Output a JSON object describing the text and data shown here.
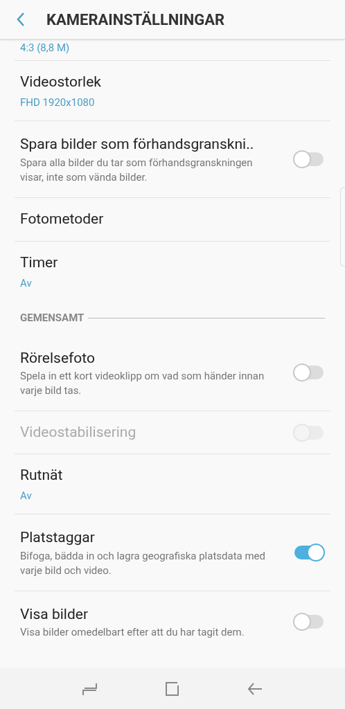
{
  "header": {
    "title": "KAMERAINSTÄLLNINGAR"
  },
  "items": [
    {
      "kind": "value_only",
      "value": "4:3 (8,8 M)"
    },
    {
      "kind": "setting",
      "title": "Videostorlek",
      "value": "FHD 1920x1080"
    },
    {
      "kind": "toggle",
      "title": "Spara bilder som förhandsgranskni..",
      "description": "Spara alla bilder du tar som förhandsgranskningen visar, inte som vända bilder.",
      "on": false,
      "disabled": false
    },
    {
      "kind": "setting",
      "title": "Fotometoder"
    },
    {
      "kind": "setting",
      "title": "Timer",
      "value": "Av"
    },
    {
      "kind": "section",
      "title": "GEMENSAMT"
    },
    {
      "kind": "toggle",
      "title": "Rörelsefoto",
      "description": "Spela in ett kort videoklipp om vad som händer innan varje bild tas.",
      "on": false,
      "disabled": false
    },
    {
      "kind": "toggle",
      "title": "Videostabilisering",
      "on": false,
      "disabled": true
    },
    {
      "kind": "setting",
      "title": "Rutnät",
      "value": "Av"
    },
    {
      "kind": "toggle",
      "title": "Platstaggar",
      "description": "Bifoga, bädda in och lagra geografiska platsdata med varje bild och video.",
      "on": true,
      "disabled": false
    },
    {
      "kind": "toggle",
      "title": "Visa bilder",
      "description": "Visa bilder omedelbart efter att du har tagit dem.",
      "on": false,
      "disabled": false
    }
  ]
}
